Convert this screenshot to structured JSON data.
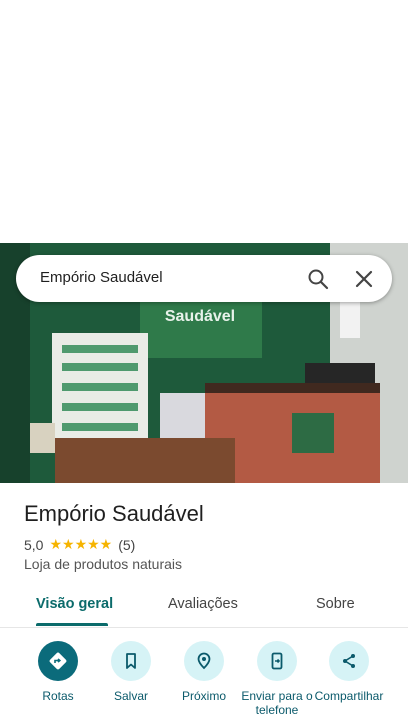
{
  "search": {
    "query": "Empório Saudável"
  },
  "place": {
    "title": "Empório Saudável",
    "rating": "5,0",
    "stars": "★★★★★",
    "review_count": "(5)",
    "category": "Loja de produtos naturais"
  },
  "photo": {
    "sign_text": "Saudável"
  },
  "tabs": [
    {
      "label": "Visão geral"
    },
    {
      "label": "Avaliações"
    },
    {
      "label": "Sobre"
    }
  ],
  "actions": [
    {
      "label": "Rotas",
      "icon": "directions-icon"
    },
    {
      "label": "Salvar",
      "icon": "bookmark-icon"
    },
    {
      "label": "Próximo",
      "icon": "nearby-icon"
    },
    {
      "label": "Enviar para o telefone",
      "icon": "send-to-phone-icon"
    },
    {
      "label": "Compartilhar",
      "icon": "share-icon"
    }
  ],
  "colors": {
    "accent": "#0b6b7b",
    "action_bg": "#d6f3f6",
    "star": "#f6b400",
    "photo_wall": "#1f5a3c"
  }
}
